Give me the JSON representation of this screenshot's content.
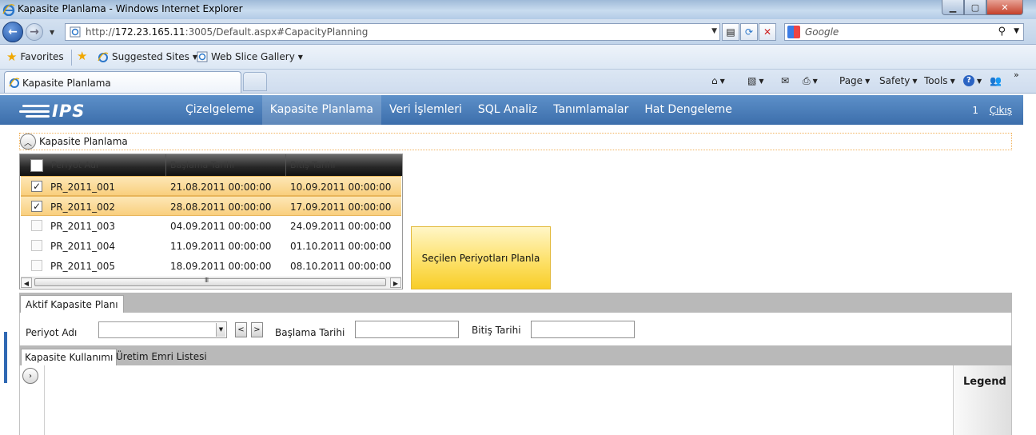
{
  "window": {
    "title": "Kapasite Planlama - Windows Internet Explorer",
    "colors": {
      "titlebar": "#b3cbe6",
      "close": "#c4402a"
    }
  },
  "address": {
    "url_prefix": "http://",
    "url_host": "172.23.165.11",
    "url_rest": ":3005/Default.aspx#CapacityPlanning",
    "search_placeholder": "Google"
  },
  "favorites": {
    "favorites_label": "Favorites",
    "suggested_label": "Suggested Sites",
    "webslice_label": "Web Slice Gallery"
  },
  "tabs": {
    "active_tab": "Kapasite Planlama"
  },
  "commandbar": {
    "page": "Page",
    "safety": "Safety",
    "tools": "Tools"
  },
  "app": {
    "logo_text": "IPS",
    "nav_color": "#3c6eab",
    "menu": [
      {
        "label": "Çizelgeleme",
        "active": false
      },
      {
        "label": "Kapasite Planlama",
        "active": true
      },
      {
        "label": "Veri İşlemleri",
        "active": false
      },
      {
        "label": "SQL Analiz",
        "active": false
      },
      {
        "label": "Tanımlamalar",
        "active": false
      },
      {
        "label": "Hat Dengeleme",
        "active": false
      }
    ],
    "user_number": "1",
    "logout_label": "Çıkış"
  },
  "section": {
    "title": "Kapasite Planlama"
  },
  "grid": {
    "columns": [
      "Periyot Adı",
      "Başlama Tarihi",
      "Bitiş Tarihi"
    ],
    "rows": [
      {
        "checked": true,
        "name": "PR_2011_001",
        "start": "21.08.2011 00:00:00",
        "end": "10.09.2011 00:00:00"
      },
      {
        "checked": true,
        "name": "PR_2011_002",
        "start": "28.08.2011 00:00:00",
        "end": "17.09.2011 00:00:00"
      },
      {
        "checked": false,
        "name": "PR_2011_003",
        "start": "04.09.2011 00:00:00",
        "end": "24.09.2011 00:00:00"
      },
      {
        "checked": false,
        "name": "PR_2011_004",
        "start": "11.09.2011 00:00:00",
        "end": "01.10.2011 00:00:00"
      },
      {
        "checked": false,
        "name": "PR_2011_005",
        "start": "18.09.2011 00:00:00",
        "end": "08.10.2011 00:00:00"
      }
    ],
    "selected_color": "#f9cf7e"
  },
  "plan_button": {
    "label": "Seçilen Periyotları Planla",
    "color": "#fde16a"
  },
  "active_plan": {
    "tab_label": "Aktif Kapasite Planı",
    "period_label": "Periyot Adı",
    "period_value": "",
    "prev_label": "<",
    "next_label": ">",
    "start_label": "Başlama Tarihi",
    "start_value": "",
    "end_label": "Bitiş Tarihi",
    "end_value": ""
  },
  "sub_tabs": {
    "usage_label": "Kapasite Kullanımı",
    "orders_label": "Üretim Emri Listesi"
  },
  "legend": {
    "title": "Legend"
  }
}
